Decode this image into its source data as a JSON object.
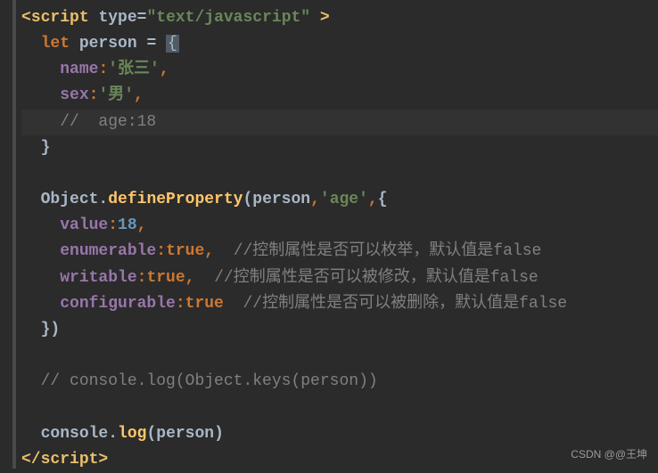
{
  "watermark": "CSDN @@王坤",
  "code": {
    "tag_open_left": "<",
    "tag_name": "script",
    "type_attr": "type",
    "eq": "=",
    "type_val": "\"text/javascript\"",
    "tag_open_right": " >",
    "let_kw": "let",
    "person_ident": "person",
    "assign": " = ",
    "brace_open": "{",
    "name_key": "name",
    "colon": ":",
    "name_val": "'张三'",
    "comma": ",",
    "sex_key": "sex",
    "sex_val": "'男'",
    "age_comment": "//  age:18",
    "brace_close": "}",
    "Object": "Object",
    "dot": ".",
    "defineProperty": "defineProperty",
    "paren_open": "(",
    "age_str": "'age'",
    "value_key": "value",
    "value_num": "18",
    "enum_key": "enumerable",
    "true_kw": "true",
    "enum_cmt": "//控制属性是否可以枚举，默认值是false",
    "writ_key": "writable",
    "writ_cmt": "//控制属性是否可以被修改，默认值是false",
    "conf_key": "configurable",
    "conf_cmt": "//控制属性是否可以被删除，默认值是false",
    "paren_close": ")",
    "keys_cmt": "// console.log(Object.keys(person))",
    "console": "console",
    "log": "log",
    "tag_close_left": "</",
    "tag_close_right": ">"
  }
}
